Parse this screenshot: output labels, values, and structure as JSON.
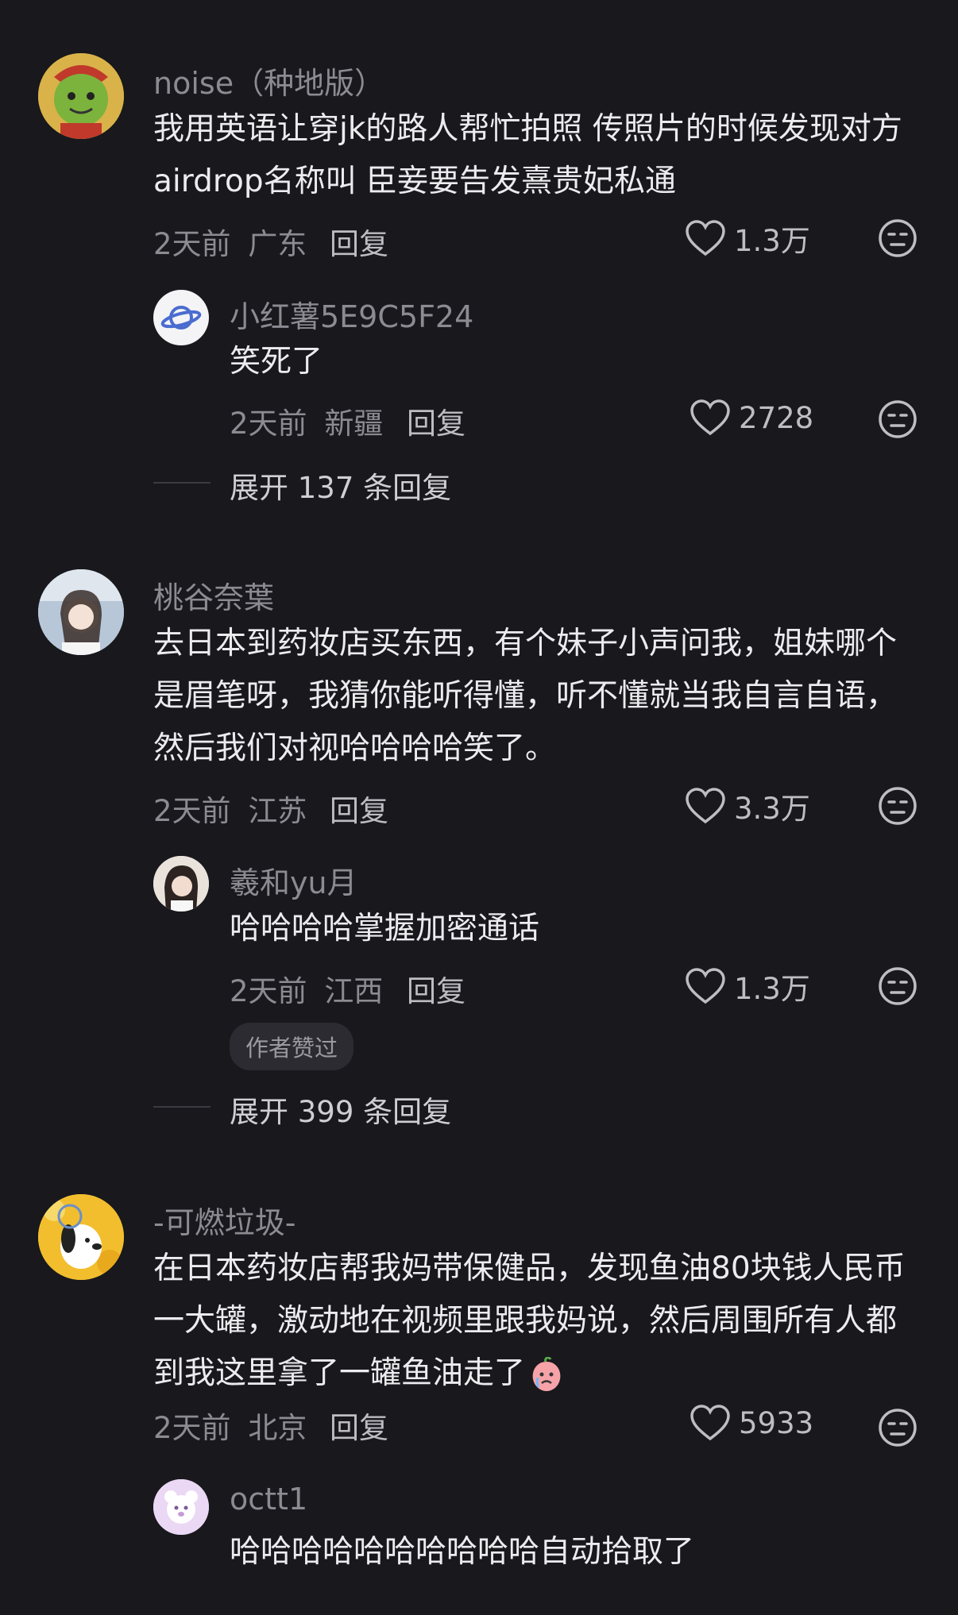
{
  "colors": {
    "background": "#18181d",
    "text_primary": "#ececef",
    "text_secondary": "#8b8b91",
    "accent_badge_bg": "#2b2b31"
  },
  "comments": [
    {
      "username": "noise（种地版）",
      "text": "我用英语让穿jk的路人帮忙拍照 传照片的时候发现对方airdrop名称叫 臣妾要告发熹贵妃私通",
      "time": "2天前",
      "location": "广东",
      "reply_label": "回复",
      "likes": "1.3万",
      "replies": [
        {
          "username": "小红薯5E9C5F24",
          "text": "笑死了",
          "time": "2天前",
          "location": "新疆",
          "reply_label": "回复",
          "likes": "2728"
        }
      ],
      "expand_label": "展开 137 条回复"
    },
    {
      "username": "桃谷奈葉",
      "text": "去日本到药妆店买东西，有个妹子小声问我，姐妹哪个是眉笔呀，我猜你能听得懂，听不懂就当我自言自语，然后我们对视哈哈哈哈笑了。",
      "time": "2天前",
      "location": "江苏",
      "reply_label": "回复",
      "likes": "3.3万",
      "replies": [
        {
          "username": "羲和yu月",
          "text": "哈哈哈哈掌握加密通话",
          "time": "2天前",
          "location": "江西",
          "reply_label": "回复",
          "likes": "1.3万",
          "badge": "作者赞过"
        }
      ],
      "expand_label": "展开 399 条回复"
    },
    {
      "username": "-可燃垃圾-",
      "text": "在日本药妆店帮我妈带保健品，发现鱼油80块钱人民币一大罐，激动地在视频里跟我妈说，然后周围所有人都到我这里拿了一罐鱼油走了",
      "time": "2天前",
      "location": "北京",
      "reply_label": "回复",
      "likes": "5933",
      "replies": [
        {
          "username": "octt1",
          "text": "哈哈哈哈哈哈哈哈哈哈自动拾取了"
        }
      ]
    }
  ],
  "icons": {
    "like": "heart-outline-icon",
    "dislike": "meh-face-icon",
    "emoji": "crying-peach-emoji"
  }
}
